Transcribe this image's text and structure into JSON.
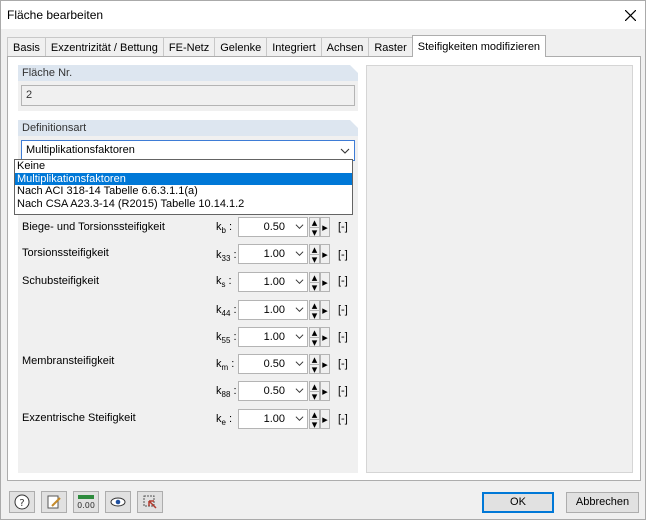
{
  "window": {
    "title": "Fläche bearbeiten"
  },
  "tabs": [
    {
      "label": "Basis"
    },
    {
      "label": "Exzentrizität / Bettung"
    },
    {
      "label": "FE-Netz"
    },
    {
      "label": "Gelenke"
    },
    {
      "label": "Integriert"
    },
    {
      "label": "Achsen"
    },
    {
      "label": "Raster"
    },
    {
      "label": "Steifigkeiten modifizieren"
    }
  ],
  "flaeche": {
    "header": "Fläche Nr.",
    "value": "2"
  },
  "definition": {
    "header": "Definitionsart",
    "selected": "Multiplikationsfaktoren",
    "options": [
      "Keine",
      "Multiplikationsfaktoren",
      "Nach ACI 318-14 Tabelle 6.6.3.1.1(a)",
      "Nach CSA A23.3-14 (R2015) Tabelle 10.14.1.2"
    ]
  },
  "stiffness": [
    {
      "label": "Biege- und Torsionssteifigkeit",
      "sym": "k",
      "sub": "b",
      "value": "0.50",
      "unit": "[-]"
    },
    {
      "label": "Torsionssteifigkeit",
      "sym": "k",
      "sub": "33",
      "value": "1.00",
      "unit": "[-]"
    },
    {
      "label": "Schubsteifigkeit",
      "sym": "k",
      "sub": "s",
      "value": "1.00",
      "unit": "[-]"
    },
    {
      "label": "",
      "sym": "k",
      "sub": "44",
      "value": "1.00",
      "unit": "[-]"
    },
    {
      "label": "",
      "sym": "k",
      "sub": "55",
      "value": "1.00",
      "unit": "[-]"
    },
    {
      "label": "Membransteifigkeit",
      "sym": "k",
      "sub": "m",
      "value": "0.50",
      "unit": "[-]"
    },
    {
      "label": "",
      "sym": "k",
      "sub": "88",
      "value": "0.50",
      "unit": "[-]"
    },
    {
      "label": "Exzentrische Steifigkeit",
      "sym": "k",
      "sub": "e",
      "value": "1.00",
      "unit": "[-]"
    }
  ],
  "buttons": {
    "ok": "OK",
    "cancel": "Abbrechen"
  },
  "icons": {
    "help": "help-icon",
    "edit": "edit-icon",
    "numeric": "numeric-icon",
    "view": "eye-icon",
    "select": "select-icon"
  },
  "colors": {
    "accent": "#0078d7",
    "header_bg": "#dde6f0"
  }
}
